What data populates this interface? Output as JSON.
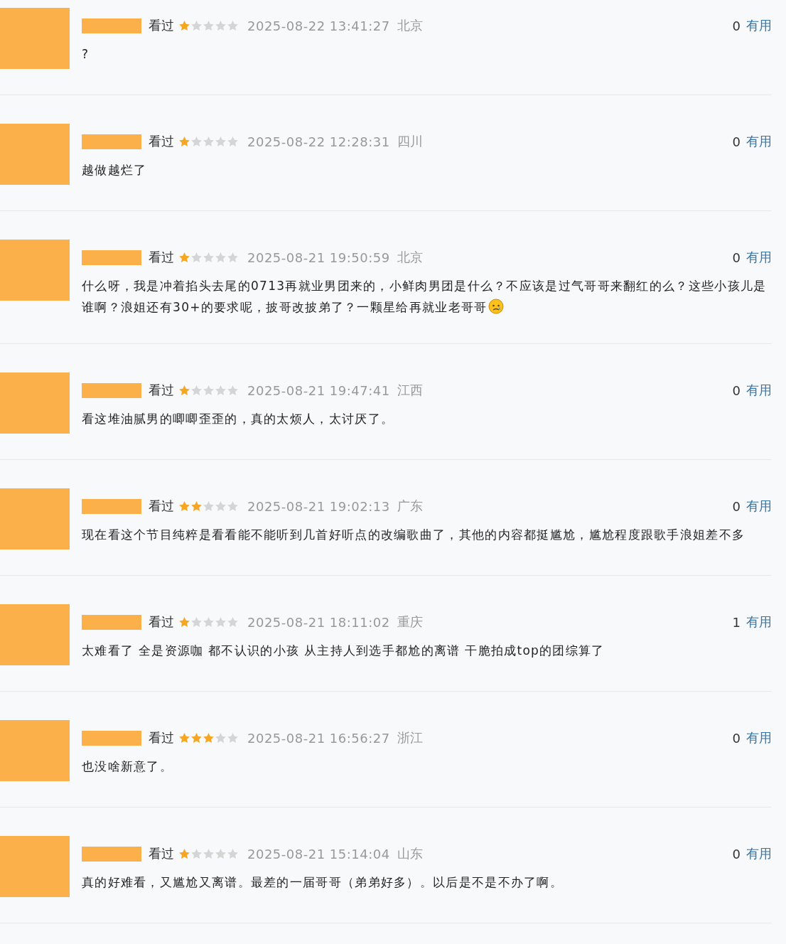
{
  "comments": [
    {
      "status": "看过",
      "stars": 1,
      "time": "2025-08-22 13:41:27",
      "location": "北京",
      "votes": "0",
      "vote_label": "有用",
      "text": "?"
    },
    {
      "status": "看过",
      "stars": 1,
      "time": "2025-08-22 12:28:31",
      "location": "四川",
      "votes": "0",
      "vote_label": "有用",
      "text": "越做越烂了"
    },
    {
      "status": "看过",
      "stars": 1,
      "time": "2025-08-21 19:50:59",
      "location": "北京",
      "votes": "0",
      "vote_label": "有用",
      "text": "什么呀，我是冲着掐头去尾的0713再就业男团来的，小鲜肉男团是什么？不应该是过气哥哥来翻红的么？这些小孩儿是谁啊？浪姐还有30+的要求呢，披哥改披弟了？一颗星给再就业老哥哥",
      "emoji": true
    },
    {
      "status": "看过",
      "stars": 1,
      "time": "2025-08-21 19:47:41",
      "location": "江西",
      "votes": "0",
      "vote_label": "有用",
      "text": "看这堆油腻男的唧唧歪歪的，真的太烦人，太讨厌了。"
    },
    {
      "status": "看过",
      "stars": 2,
      "time": "2025-08-21 19:02:13",
      "location": "广东",
      "votes": "0",
      "vote_label": "有用",
      "text": "现在看这个节目纯粹是看看能不能听到几首好听点的改编歌曲了，其他的内容都挺尴尬，尴尬程度跟歌手浪姐差不多"
    },
    {
      "status": "看过",
      "stars": 1,
      "time": "2025-08-21 18:11:02",
      "location": "重庆",
      "votes": "1",
      "vote_label": "有用",
      "text": "太难看了 全是资源咖 都不认识的小孩 从主持人到选手都尬的离谱 干脆拍成top的团综算了"
    },
    {
      "status": "看过",
      "stars": 3,
      "time": "2025-08-21 16:56:27",
      "location": "浙江",
      "votes": "0",
      "vote_label": "有用",
      "text": "也没啥新意了。"
    },
    {
      "status": "看过",
      "stars": 1,
      "time": "2025-08-21 15:14:04",
      "location": "山东",
      "votes": "0",
      "vote_label": "有用",
      "text": "真的好难看，又尴尬又离谱。最差的一届哥哥（弟弟好多）。以后是不是不办了啊。"
    }
  ]
}
